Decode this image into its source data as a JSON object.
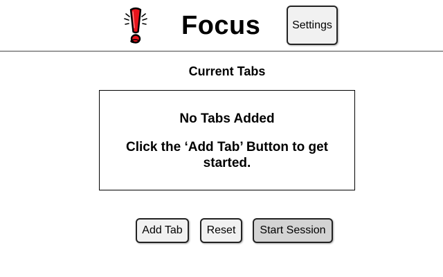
{
  "header": {
    "app_title": "Focus",
    "logo_icon": "exclamation-icon",
    "settings_label": "Settings"
  },
  "tabs_section": {
    "title": "Current Tabs",
    "empty_title": "No Tabs Added",
    "empty_hint": "Click the ‘Add Tab’ Button to get started."
  },
  "actions": {
    "add_tab_label": "Add Tab",
    "reset_label": "Reset",
    "start_session_label": "Start Session"
  },
  "colors": {
    "logo_red": "#e8141c",
    "button_bg": "#f1f1f1",
    "start_button_bg": "#d3d3d3",
    "divider": "#9a9a9a"
  }
}
